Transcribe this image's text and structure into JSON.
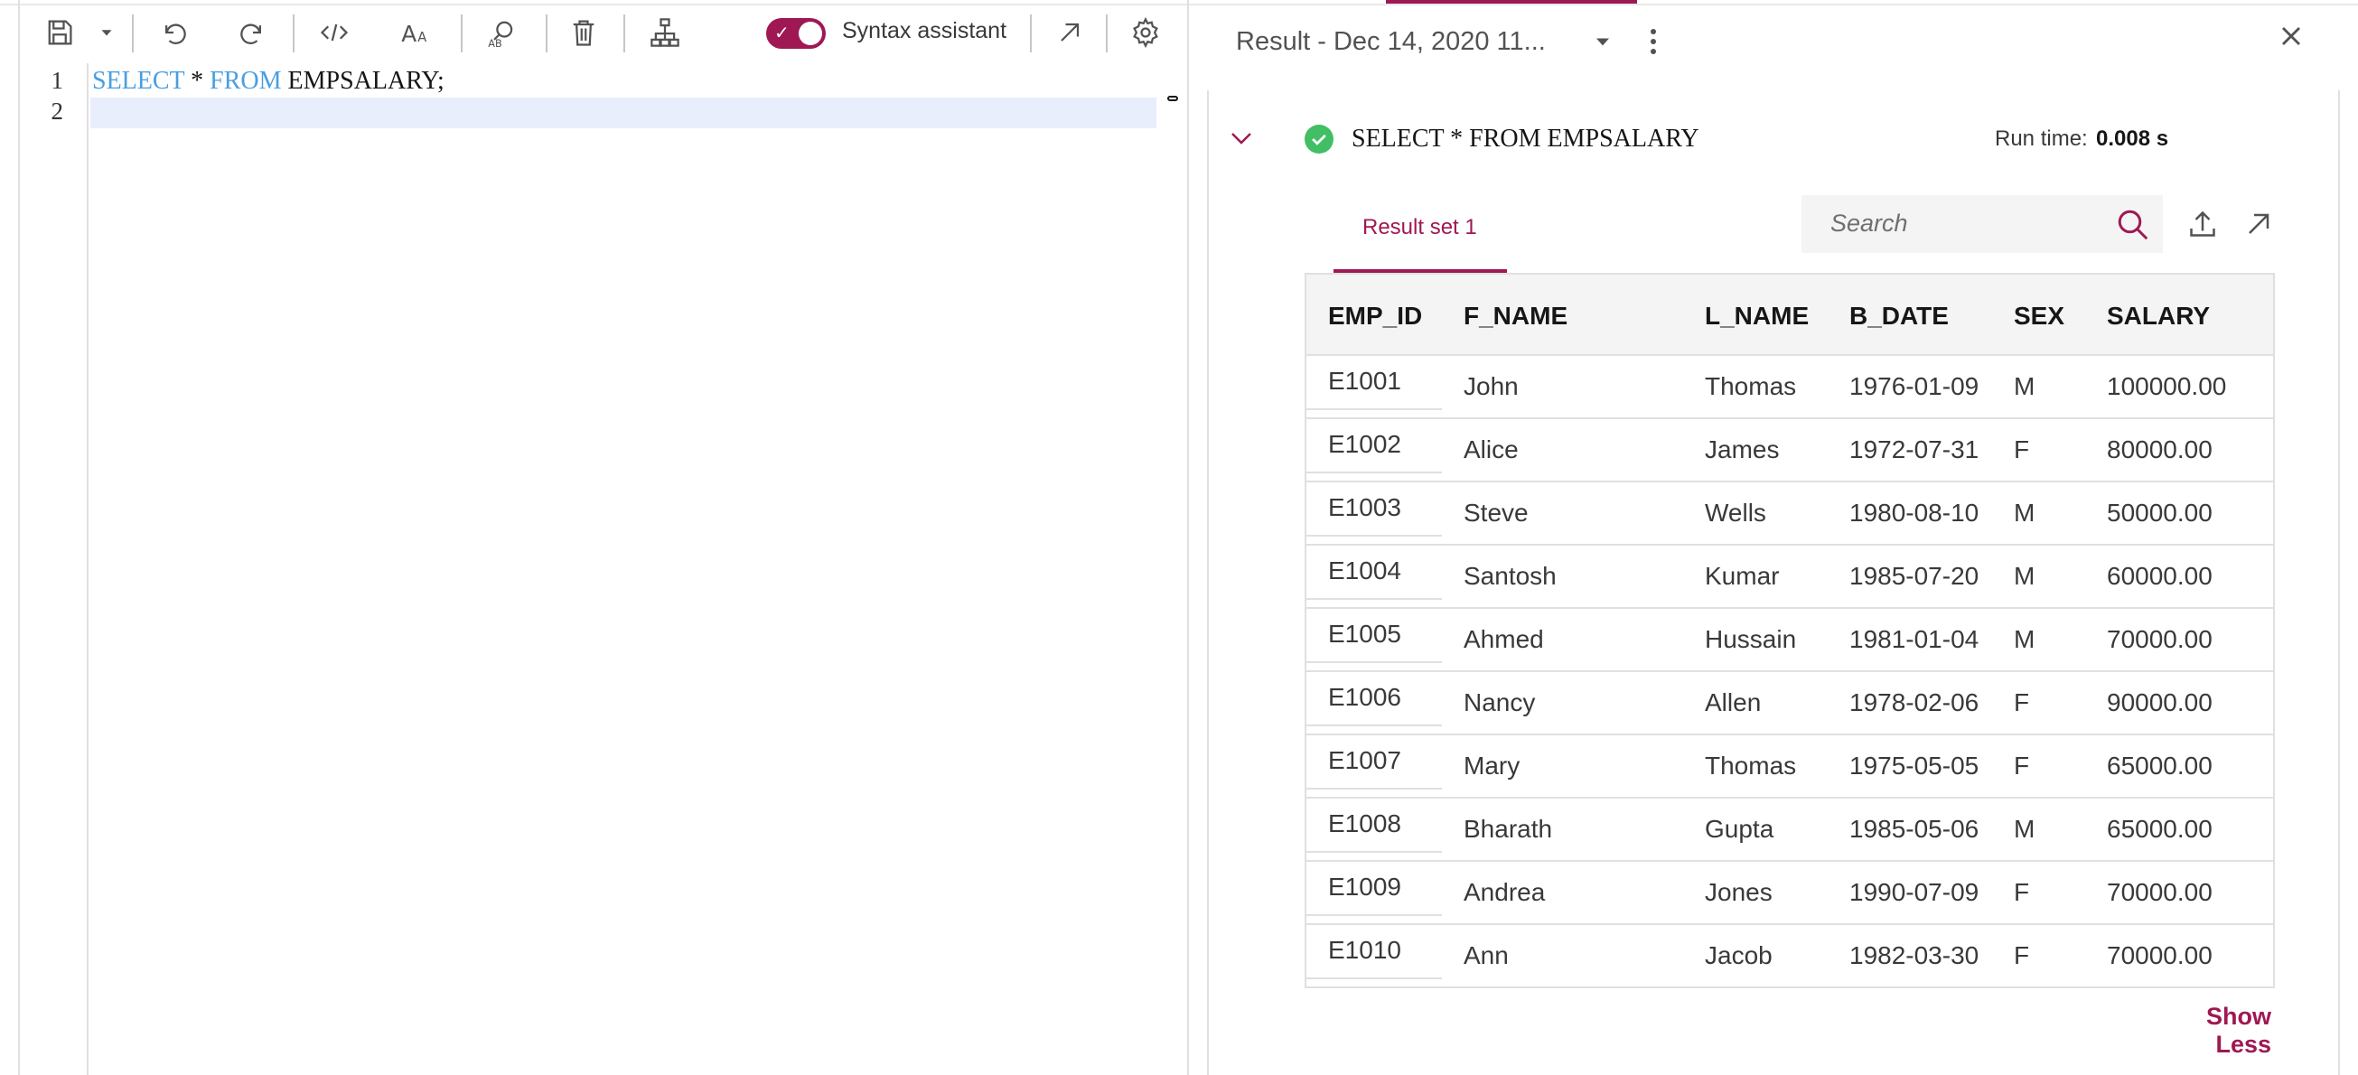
{
  "toolbar": {
    "syntax_assistant_label": "Syntax assistant",
    "toggle_on": true,
    "icons": [
      "save-icon",
      "dropdown-caret-icon",
      "undo-icon",
      "redo-icon",
      "code-icon",
      "font-size-icon",
      "find-replace-icon",
      "delete-icon",
      "explain-tree-icon",
      "popout-icon",
      "settings-icon"
    ]
  },
  "editor": {
    "line_numbers": [
      "1",
      "2"
    ],
    "line1": {
      "kw1": "SELECT",
      "op": " * ",
      "kw2": "FROM",
      "rest": " EMPSALARY;"
    }
  },
  "result": {
    "dropdown_title": "Result - Dec 14, 2020 11...",
    "query_text": "SELECT * FROM EMPSALARY",
    "run_time_label": "Run time:",
    "run_time_value": "0.008 s",
    "tab_label": "Result set 1",
    "search_placeholder": "Search",
    "show_less": "Show Less",
    "accent_color": "#9f1853",
    "success_color": "#42be65"
  },
  "table": {
    "columns": [
      "EMP_ID",
      "F_NAME",
      "L_NAME",
      "B_DATE",
      "SEX",
      "SALARY"
    ],
    "rows": [
      [
        "E1001",
        "John",
        "Thomas",
        "1976-01-09",
        "M",
        "100000.00"
      ],
      [
        "E1002",
        "Alice",
        "James",
        "1972-07-31",
        "F",
        "80000.00"
      ],
      [
        "E1003",
        "Steve",
        "Wells",
        "1980-08-10",
        "M",
        "50000.00"
      ],
      [
        "E1004",
        "Santosh",
        "Kumar",
        "1985-07-20",
        "M",
        "60000.00"
      ],
      [
        "E1005",
        "Ahmed",
        "Hussain",
        "1981-01-04",
        "M",
        "70000.00"
      ],
      [
        "E1006",
        "Nancy",
        "Allen",
        "1978-02-06",
        "F",
        "90000.00"
      ],
      [
        "E1007",
        "Mary",
        "Thomas",
        "1975-05-05",
        "F",
        "65000.00"
      ],
      [
        "E1008",
        "Bharath",
        "Gupta",
        "1985-05-06",
        "M",
        "65000.00"
      ],
      [
        "E1009",
        "Andrea",
        "Jones",
        "1990-07-09",
        "F",
        "70000.00"
      ],
      [
        "E1010",
        "Ann",
        "Jacob",
        "1982-03-30",
        "F",
        "70000.00"
      ]
    ]
  }
}
